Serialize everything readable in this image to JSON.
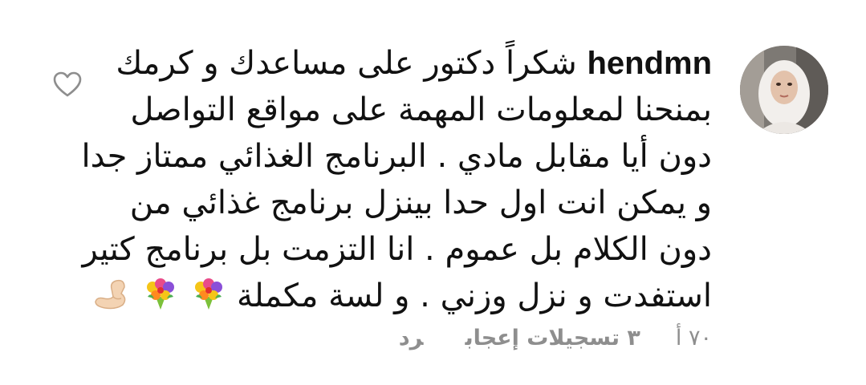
{
  "comment": {
    "username": "hendmn",
    "text_lines": [
      "شكراً دكتور على مساعدك و كرمك",
      "بمنحنا لمعلومات المهمة على مواقع التواصل",
      "دون أيا مقابل مادي . البرنامج الغذائي ممتاز جدا",
      "و يمكن انت اول حدا بينزل برنامج غذائي من",
      "دون الكلام بل عموم . انا التزمت بل برنامج كتير",
      "استفدت و نزل وزني . و لسة مكملة"
    ],
    "emojis": [
      "bouquet-icon",
      "bouquet-icon",
      "flexed-biceps-icon"
    ],
    "time": "٧٠ أ",
    "likes": "٣ تسجيلات إعجاب",
    "reply": "رد"
  },
  "colors": {
    "text": "#111111",
    "meta": "#8e8e8e",
    "icon": "#8e8e8e"
  }
}
